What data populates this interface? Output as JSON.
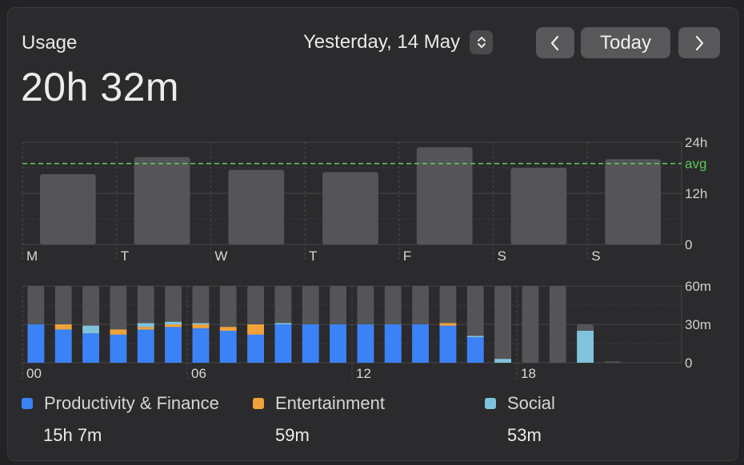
{
  "header": {
    "title": "Usage",
    "total": "20h 32m",
    "date": "Yesterday, 14 May",
    "today_label": "Today",
    "prev_icon": "chevron-left-icon",
    "next_icon": "chevron-right-icon",
    "stepper_icon": "up-down-chevron-icon"
  },
  "colors": {
    "productivity": "#3b82f6",
    "entertainment": "#f0a33a",
    "social": "#7fc3dc",
    "other": "#555557",
    "avg": "#5ac85a"
  },
  "chart_data": [
    {
      "type": "bar",
      "categories": [
        "M",
        "T",
        "W",
        "T",
        "F",
        "S",
        "S"
      ],
      "values": [
        16.5,
        20.5,
        17.5,
        17,
        22.8,
        18,
        20
      ],
      "avg": 19,
      "avg_label": "avg",
      "yticks": [
        "24h",
        "12h",
        "0"
      ],
      "ylim": [
        0,
        24
      ],
      "unit": "hours"
    },
    {
      "type": "bar",
      "stacked": true,
      "xticks": [
        "00",
        "06",
        "12",
        "18"
      ],
      "yticks": [
        "60m",
        "30m",
        "0"
      ],
      "ylim": [
        0,
        60
      ],
      "unit": "minutes",
      "series_names": [
        "Productivity & Finance",
        "Entertainment",
        "Social"
      ],
      "hours": [
        {
          "productivity": 30,
          "entertainment": 0,
          "social": 0,
          "total": 60
        },
        {
          "productivity": 26,
          "entertainment": 4,
          "social": 0,
          "total": 60
        },
        {
          "productivity": 23,
          "entertainment": 0,
          "social": 6,
          "total": 60
        },
        {
          "productivity": 22,
          "entertainment": 4,
          "social": 0,
          "total": 60
        },
        {
          "productivity": 26,
          "entertainment": 2,
          "social": 3,
          "total": 60
        },
        {
          "productivity": 28,
          "entertainment": 2,
          "social": 2,
          "total": 60
        },
        {
          "productivity": 27,
          "entertainment": 3,
          "social": 1,
          "total": 60
        },
        {
          "productivity": 25,
          "entertainment": 3,
          "social": 0,
          "total": 60
        },
        {
          "productivity": 22,
          "entertainment": 8,
          "social": 0,
          "total": 60
        },
        {
          "productivity": 30,
          "entertainment": 0,
          "social": 1,
          "total": 60
        },
        {
          "productivity": 30,
          "entertainment": 0,
          "social": 0,
          "total": 60
        },
        {
          "productivity": 30,
          "entertainment": 0,
          "social": 0,
          "total": 60
        },
        {
          "productivity": 30,
          "entertainment": 0,
          "social": 0,
          "total": 60
        },
        {
          "productivity": 30,
          "entertainment": 0,
          "social": 0,
          "total": 60
        },
        {
          "productivity": 30,
          "entertainment": 0,
          "social": 0,
          "total": 60
        },
        {
          "productivity": 29,
          "entertainment": 2,
          "social": 0,
          "total": 60
        },
        {
          "productivity": 20,
          "entertainment": 0,
          "social": 1,
          "total": 60
        },
        {
          "productivity": 0,
          "entertainment": 0,
          "social": 3,
          "total": 60
        },
        {
          "productivity": 0,
          "entertainment": 0,
          "social": 0,
          "total": 60
        },
        {
          "productivity": 0,
          "entertainment": 0,
          "social": 0,
          "total": 60
        },
        {
          "productivity": 0,
          "entertainment": 0,
          "social": 25,
          "total": 30
        },
        {
          "productivity": 0,
          "entertainment": 0,
          "social": 0,
          "total": 1
        },
        {
          "productivity": 0,
          "entertainment": 0,
          "social": 0,
          "total": 0
        },
        {
          "productivity": 0,
          "entertainment": 0,
          "social": 0,
          "total": 0
        }
      ]
    }
  ],
  "legend": [
    {
      "label": "Productivity & Finance",
      "value": "15h 7m",
      "color": "#3b82f6"
    },
    {
      "label": "Entertainment",
      "value": "59m",
      "color": "#f0a33a"
    },
    {
      "label": "Social",
      "value": "53m",
      "color": "#7fc3dc"
    }
  ]
}
